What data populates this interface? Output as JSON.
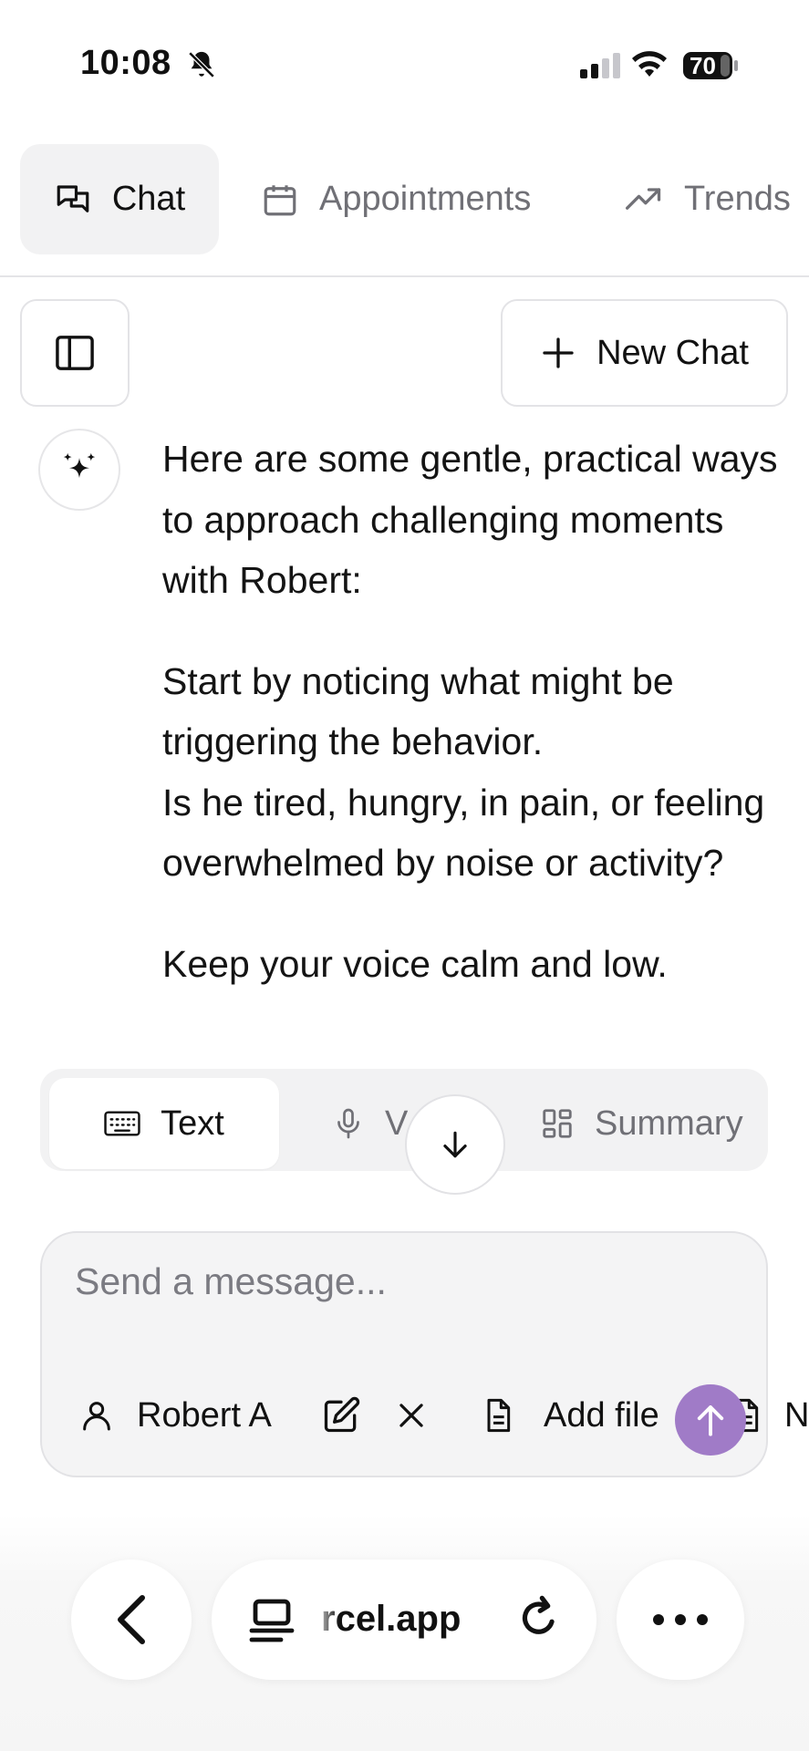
{
  "status_bar": {
    "time": "10:08",
    "battery": "70"
  },
  "top_tabs": [
    {
      "label": "Chat",
      "icon": "chat-bubbles-icon",
      "active": true
    },
    {
      "label": "Appointments",
      "icon": "calendar-icon",
      "active": false
    },
    {
      "label": "Trends",
      "icon": "trending-up-icon",
      "active": false
    }
  ],
  "toolbar": {
    "new_chat_label": "New Chat"
  },
  "message": {
    "paragraphs": [
      "Here are some gentle, practical ways to approach challenging moments with Robert:",
      "Start by noticing what might be triggering the behavior.",
      "Is he tired, hungry, in pain, or feeling overwhelmed by noise or activity?",
      "Keep your voice calm and low."
    ]
  },
  "mode_tabs": [
    {
      "label": "Text",
      "icon": "keyboard-icon",
      "active": true
    },
    {
      "label": "V",
      "icon": "microphone-icon",
      "active": false
    },
    {
      "label": "Summary",
      "icon": "grid-icon",
      "active": false
    }
  ],
  "input": {
    "placeholder": "Send a message...",
    "person_chip": "Robert A",
    "add_file_label": "Add file",
    "note_chip": "N"
  },
  "browser": {
    "url": "rcel.app"
  },
  "colors": {
    "send_button": "#a07bc7",
    "active_tab_bg": "#f2f2f3"
  }
}
